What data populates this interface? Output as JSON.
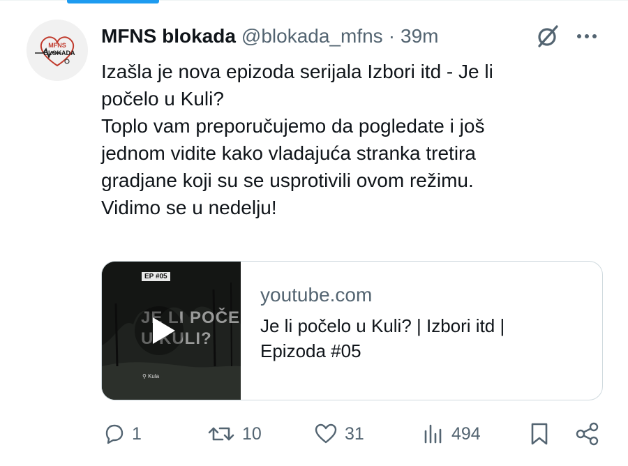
{
  "tweet": {
    "display_name": "MFNS blokada",
    "handle": "@blokada_mfns",
    "separator": "·",
    "time": "39m",
    "avatar_text_top": "MFNS",
    "avatar_text_bottom": "BLOKADA",
    "text_lines": [
      "Izašla je nova epizoda serijala Izbori itd - Je li",
      "počelo u Kuli?",
      "Toplo vam preporučujemo da pogledate i još",
      "jednom vidite kako vladajuća stranka tretira",
      "gradjane koji su se usprotivili ovom režimu.",
      "Vidimo se u nedelju!"
    ]
  },
  "card": {
    "domain": "youtube.com",
    "title_lines": [
      "Je li počelo u Kuli? | Izbori itd |",
      "Epizoda #05"
    ],
    "thumbnail": {
      "badge": "EP #05",
      "title_line1": "JE LI POČE",
      "title_line2": "U KULI?",
      "location": "Kula"
    }
  },
  "actions": {
    "reply_count": "1",
    "retweet_count": "10",
    "like_count": "31",
    "views_count": "494"
  },
  "icons": {
    "header": [
      "grok-icon",
      "more-icon"
    ],
    "actions": [
      "reply-icon",
      "retweet-icon",
      "like-icon",
      "views-icon",
      "bookmark-icon",
      "share-icon"
    ]
  },
  "colors": {
    "text": "#0f1419",
    "secondary": "#536471",
    "border": "#cfd9de",
    "accent": "#1d9bf0",
    "avatar_heart": "#c0392b"
  }
}
